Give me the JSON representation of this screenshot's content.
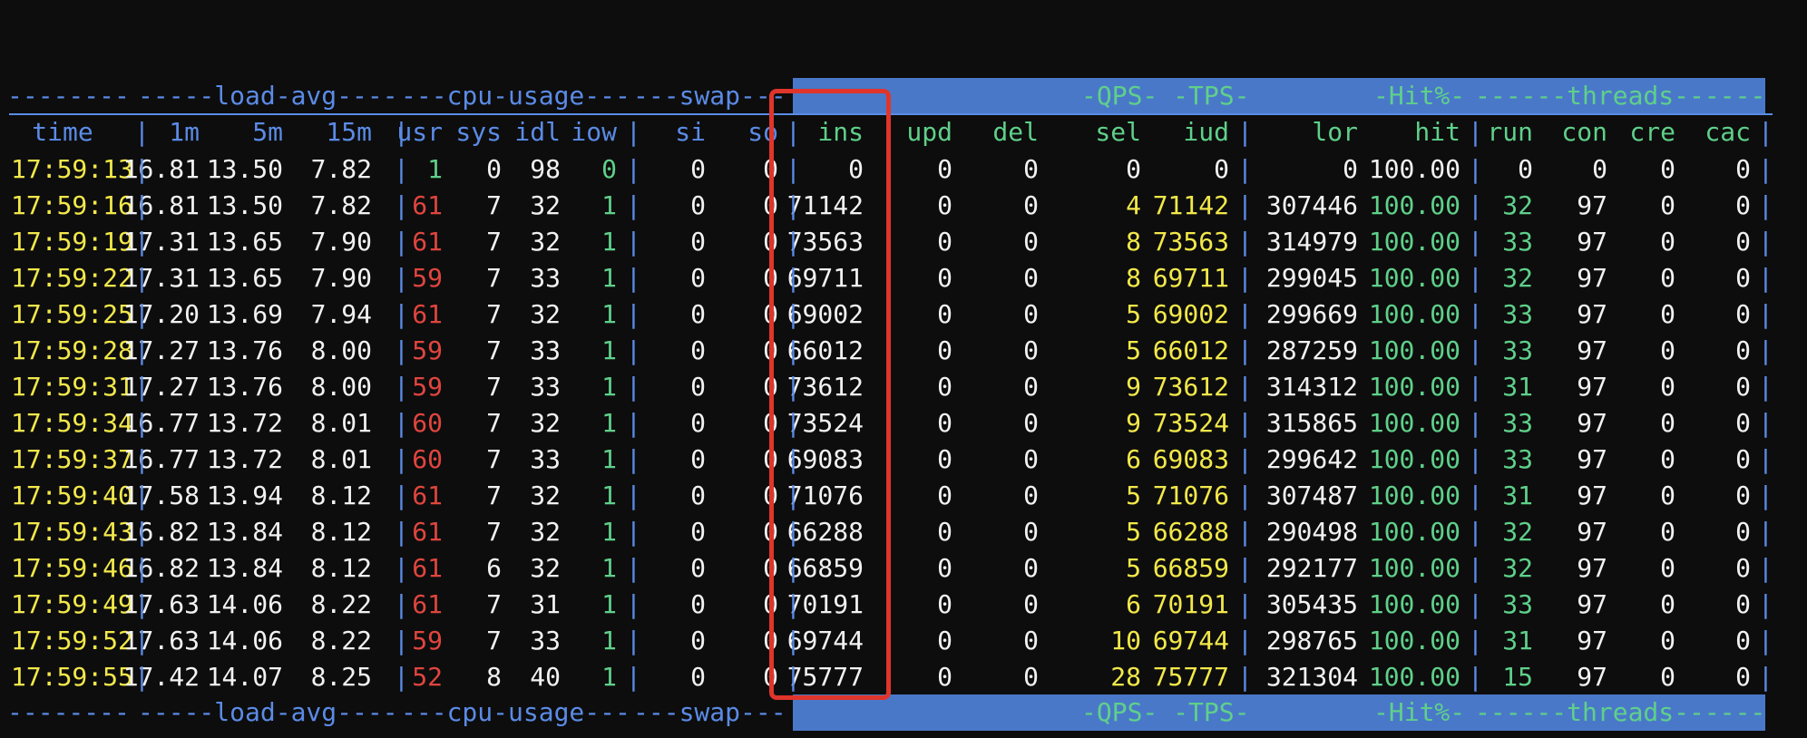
{
  "headers": {
    "group_time": "--------",
    "group_load": "-----load-avg----",
    "group_cpu": "---cpu-usage---",
    "group_swap": "---swap---",
    "group_qps": "-QPS- -TPS-",
    "group_hit": "-Hit%-",
    "group_threads": "------threads------",
    "columns": [
      "time",
      "1m",
      "5m",
      "15m",
      "usr",
      "sys",
      "idl",
      "iow",
      "si",
      "so",
      "ins",
      "upd",
      "del",
      "sel",
      "iud",
      "lor",
      "hit",
      "run",
      "con",
      "cre",
      "cac"
    ]
  },
  "colors": {
    "background": "#0d0d0d",
    "time": "#f2e84a",
    "default": "#f2f2f2",
    "usr_high": "#e0453f",
    "ok_green": "#5fd08a",
    "warn_yellow": "#f2e84a",
    "separator_blue": "#5b8be6",
    "header_band": "#4a78c9",
    "highlight_box": "#e0352b"
  },
  "rows": [
    [
      "17:59:13",
      "16.81",
      "13.50",
      "7.82",
      "1",
      "0",
      "98",
      "0",
      "0",
      "0",
      "0",
      "0",
      "0",
      "0",
      "0",
      "0",
      "100.00",
      "0",
      "0",
      "0",
      "0"
    ],
    [
      "17:59:16",
      "16.81",
      "13.50",
      "7.82",
      "61",
      "7",
      "32",
      "1",
      "0",
      "0",
      "71142",
      "0",
      "0",
      "4",
      "71142",
      "307446",
      "100.00",
      "32",
      "97",
      "0",
      "0"
    ],
    [
      "17:59:19",
      "17.31",
      "13.65",
      "7.90",
      "61",
      "7",
      "32",
      "1",
      "0",
      "0",
      "73563",
      "0",
      "0",
      "8",
      "73563",
      "314979",
      "100.00",
      "33",
      "97",
      "0",
      "0"
    ],
    [
      "17:59:22",
      "17.31",
      "13.65",
      "7.90",
      "59",
      "7",
      "33",
      "1",
      "0",
      "0",
      "69711",
      "0",
      "0",
      "8",
      "69711",
      "299045",
      "100.00",
      "32",
      "97",
      "0",
      "0"
    ],
    [
      "17:59:25",
      "17.20",
      "13.69",
      "7.94",
      "61",
      "7",
      "32",
      "1",
      "0",
      "0",
      "69002",
      "0",
      "0",
      "5",
      "69002",
      "299669",
      "100.00",
      "33",
      "97",
      "0",
      "0"
    ],
    [
      "17:59:28",
      "17.27",
      "13.76",
      "8.00",
      "59",
      "7",
      "33",
      "1",
      "0",
      "0",
      "66012",
      "0",
      "0",
      "5",
      "66012",
      "287259",
      "100.00",
      "33",
      "97",
      "0",
      "0"
    ],
    [
      "17:59:31",
      "17.27",
      "13.76",
      "8.00",
      "59",
      "7",
      "33",
      "1",
      "0",
      "0",
      "73612",
      "0",
      "0",
      "9",
      "73612",
      "314312",
      "100.00",
      "31",
      "97",
      "0",
      "0"
    ],
    [
      "17:59:34",
      "16.77",
      "13.72",
      "8.01",
      "60",
      "7",
      "32",
      "1",
      "0",
      "0",
      "73524",
      "0",
      "0",
      "9",
      "73524",
      "315865",
      "100.00",
      "33",
      "97",
      "0",
      "0"
    ],
    [
      "17:59:37",
      "16.77",
      "13.72",
      "8.01",
      "60",
      "7",
      "33",
      "1",
      "0",
      "0",
      "69083",
      "0",
      "0",
      "6",
      "69083",
      "299642",
      "100.00",
      "33",
      "97",
      "0",
      "0"
    ],
    [
      "17:59:40",
      "17.58",
      "13.94",
      "8.12",
      "61",
      "7",
      "32",
      "1",
      "0",
      "0",
      "71076",
      "0",
      "0",
      "5",
      "71076",
      "307487",
      "100.00",
      "31",
      "97",
      "0",
      "0"
    ],
    [
      "17:59:43",
      "16.82",
      "13.84",
      "8.12",
      "61",
      "7",
      "32",
      "1",
      "0",
      "0",
      "66288",
      "0",
      "0",
      "5",
      "66288",
      "290498",
      "100.00",
      "32",
      "97",
      "0",
      "0"
    ],
    [
      "17:59:46",
      "16.82",
      "13.84",
      "8.12",
      "61",
      "6",
      "32",
      "1",
      "0",
      "0",
      "66859",
      "0",
      "0",
      "5",
      "66859",
      "292177",
      "100.00",
      "32",
      "97",
      "0",
      "0"
    ],
    [
      "17:59:49",
      "17.63",
      "14.06",
      "8.22",
      "61",
      "7",
      "31",
      "1",
      "0",
      "0",
      "70191",
      "0",
      "0",
      "6",
      "70191",
      "305435",
      "100.00",
      "33",
      "97",
      "0",
      "0"
    ],
    [
      "17:59:52",
      "17.63",
      "14.06",
      "8.22",
      "59",
      "7",
      "33",
      "1",
      "0",
      "0",
      "69744",
      "0",
      "0",
      "10",
      "69744",
      "298765",
      "100.00",
      "31",
      "97",
      "0",
      "0"
    ],
    [
      "17:59:55",
      "17.42",
      "14.07",
      "8.25",
      "52",
      "8",
      "40",
      "1",
      "0",
      "0",
      "75777",
      "0",
      "0",
      "28",
      "75777",
      "321304",
      "100.00",
      "15",
      "97",
      "0",
      "0"
    ]
  ]
}
